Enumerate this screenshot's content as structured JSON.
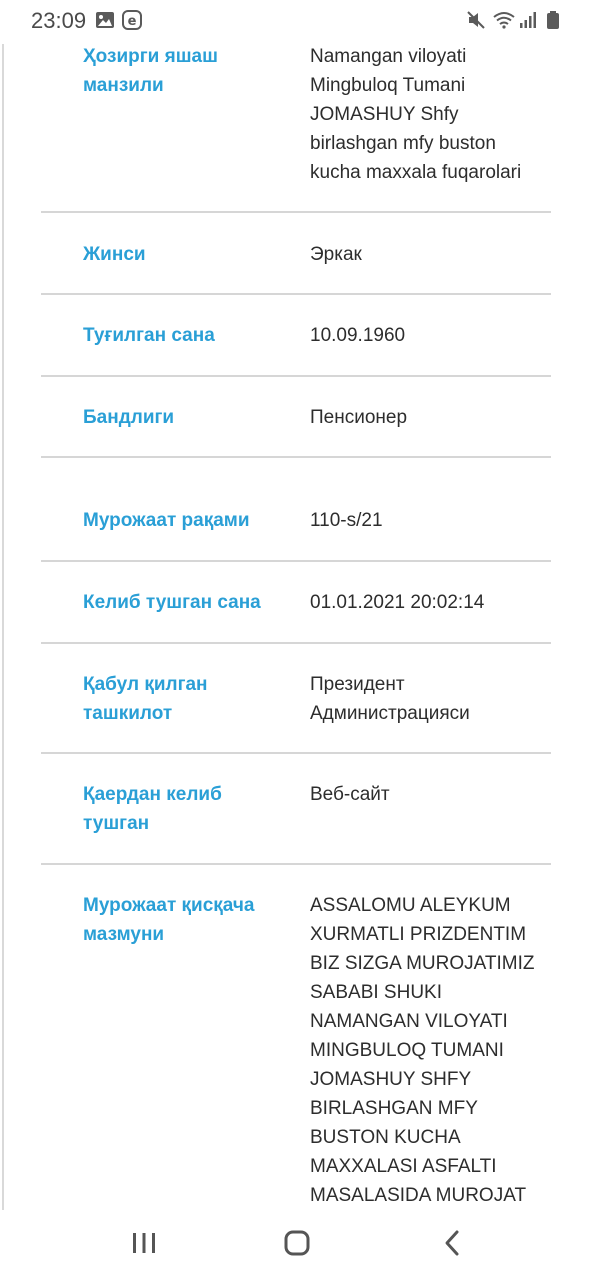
{
  "status_bar": {
    "time": "23:09",
    "icons": [
      "gallery-icon",
      "e-app-icon",
      "mute-icon",
      "wifi-icon",
      "signal-icon",
      "battery-icon"
    ]
  },
  "rows": [
    {
      "label": "Ҳозирги яшаш манзили",
      "value": "Namangan viloyati Mingbuloq Tumani JOMASHUY Shfy birlashgan mfy buston kucha maxxala fuqarolari"
    },
    {
      "label": "Жинси",
      "value": "Эркак"
    },
    {
      "label": "Туғилган сана",
      "value": "10.09.1960"
    },
    {
      "label": "Бандлиги",
      "value": "Пенсионер"
    },
    {
      "label": "Мурожаат рақами",
      "value": "110-s/21"
    },
    {
      "label": "Келиб тушган сана",
      "value": "01.01.2021 20:02:14"
    },
    {
      "label": "Қабул қилган ташкилот",
      "value": "Президент Администрацияси"
    },
    {
      "label": "Қаердан келиб тушган",
      "value": "Веб-сайт"
    },
    {
      "label": "Мурожаат қисқача мазмуни",
      "value": "ASSALOMU ALEYKUM XURMATLI PRIZDENTIM BIZ SIZGA MUROJATIMIZ SABABI SHUKI NAMANGAN VILOYATI MINGBULOQ TUMANI JOMASHUY SHFY BIRLASHGAN MFY BUSTON KUCHA MAXXALASI ASFALTI MASALASIDA MUROJAT"
    }
  ],
  "colors": {
    "label": "#2a9fd6",
    "value": "#2d2d2d",
    "divider": "#d6d6d6"
  },
  "nav": [
    "recent-apps-icon",
    "home-icon",
    "back-icon"
  ]
}
